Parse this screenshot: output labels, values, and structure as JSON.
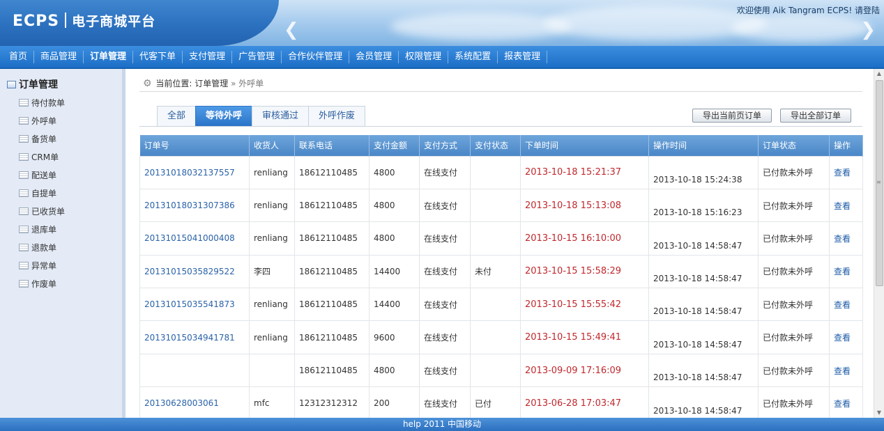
{
  "header": {
    "logo": "ECPS",
    "logo_sub": "电子商城平台",
    "welcome": "欢迎使用 Aik Tangram ECPS!  请登陆",
    "prev_icon": "chevron-left-icon",
    "next_icon": "chevron-right-icon"
  },
  "nav": {
    "items": [
      {
        "label": "首页"
      },
      {
        "label": "商品管理"
      },
      {
        "label": "订单管理"
      },
      {
        "label": "代客下单"
      },
      {
        "label": "支付管理"
      },
      {
        "label": "广告管理"
      },
      {
        "label": "合作伙伴管理"
      },
      {
        "label": "会员管理"
      },
      {
        "label": "权限管理"
      },
      {
        "label": "系统配置"
      },
      {
        "label": "报表管理"
      }
    ],
    "active": "订单管理"
  },
  "sidebar": {
    "title": "订单管理",
    "items": [
      {
        "label": "待付款单"
      },
      {
        "label": "外呼单"
      },
      {
        "label": "备货单"
      },
      {
        "label": "CRM单"
      },
      {
        "label": "配送单"
      },
      {
        "label": "自提单"
      },
      {
        "label": "已收货单"
      },
      {
        "label": "退库单"
      },
      {
        "label": "退款单"
      },
      {
        "label": "异常单"
      },
      {
        "label": "作废单"
      }
    ]
  },
  "breadcrumb": {
    "prefix": "当前位置:",
    "section": "订单管理",
    "separator": "»",
    "current": "外呼单"
  },
  "tabs": [
    {
      "label": "全部"
    },
    {
      "label": "等待外呼"
    },
    {
      "label": "审核通过"
    },
    {
      "label": "外呼作废"
    }
  ],
  "active_tab": "等待外呼",
  "buttons": {
    "export_page": "导出当前页订单",
    "export_all": "导出全部订单"
  },
  "table": {
    "headers": [
      "订单号",
      "收货人",
      "联系电话",
      "支付金额",
      "支付方式",
      "支付状态",
      "下单时间",
      "操作时间",
      "订单状态",
      "操作"
    ],
    "rows": [
      {
        "id": "20131018032137557",
        "receiver": "renliang",
        "phone": "18612110485",
        "amount": "4800",
        "pay_method": "在线支付",
        "pay_status": "",
        "order_time": "2013-10-18 15:21:37",
        "op_time": "2013-10-18 15:24:38",
        "status": "已付款未外呼",
        "action": "查看"
      },
      {
        "id": "20131018031307386",
        "receiver": "renliang",
        "phone": "18612110485",
        "amount": "4800",
        "pay_method": "在线支付",
        "pay_status": "",
        "order_time": "2013-10-18 15:13:08",
        "op_time": "2013-10-18 15:16:23",
        "status": "已付款未外呼",
        "action": "查看"
      },
      {
        "id": "20131015041000408",
        "receiver": "renliang",
        "phone": "18612110485",
        "amount": "4800",
        "pay_method": "在线支付",
        "pay_status": "",
        "order_time": "2013-10-15 16:10:00",
        "op_time": "2013-10-18 14:58:47",
        "status": "已付款未外呼",
        "action": "查看"
      },
      {
        "id": "20131015035829522",
        "receiver": "李四",
        "phone": "18612110485",
        "amount": "14400",
        "pay_method": "在线支付",
        "pay_status": "未付",
        "order_time": "2013-10-15 15:58:29",
        "op_time": "2013-10-18 14:58:47",
        "status": "已付款未外呼",
        "action": "查看"
      },
      {
        "id": "20131015035541873",
        "receiver": "renliang",
        "phone": "18612110485",
        "amount": "14400",
        "pay_method": "在线支付",
        "pay_status": "",
        "order_time": "2013-10-15 15:55:42",
        "op_time": "2013-10-18 14:58:47",
        "status": "已付款未外呼",
        "action": "查看"
      },
      {
        "id": "20131015034941781",
        "receiver": "renliang",
        "phone": "18612110485",
        "amount": "9600",
        "pay_method": "在线支付",
        "pay_status": "",
        "order_time": "2013-10-15 15:49:41",
        "op_time": "2013-10-18 14:58:47",
        "status": "已付款未外呼",
        "action": "查看"
      },
      {
        "id": "",
        "receiver": "",
        "phone": "18612110485",
        "amount": "4800",
        "pay_method": "在线支付",
        "pay_status": "",
        "order_time": "2013-09-09 17:16:09",
        "op_time": "2013-10-18 14:58:47",
        "status": "已付款未外呼",
        "action": "查看"
      },
      {
        "id": "20130628003061",
        "receiver": "mfc",
        "phone": "12312312312",
        "amount": "200",
        "pay_method": "在线支付",
        "pay_status": "已付",
        "order_time": "2013-06-28 17:03:47",
        "op_time": "2013-10-18 14:58:47",
        "status": "已付款未外呼",
        "action": "查看"
      }
    ]
  },
  "footer": {
    "text": "help 2011 中国移动"
  },
  "colors": {
    "primary": "#2b74c8",
    "order_time": "#c0282d",
    "link": "#2a62a8"
  }
}
